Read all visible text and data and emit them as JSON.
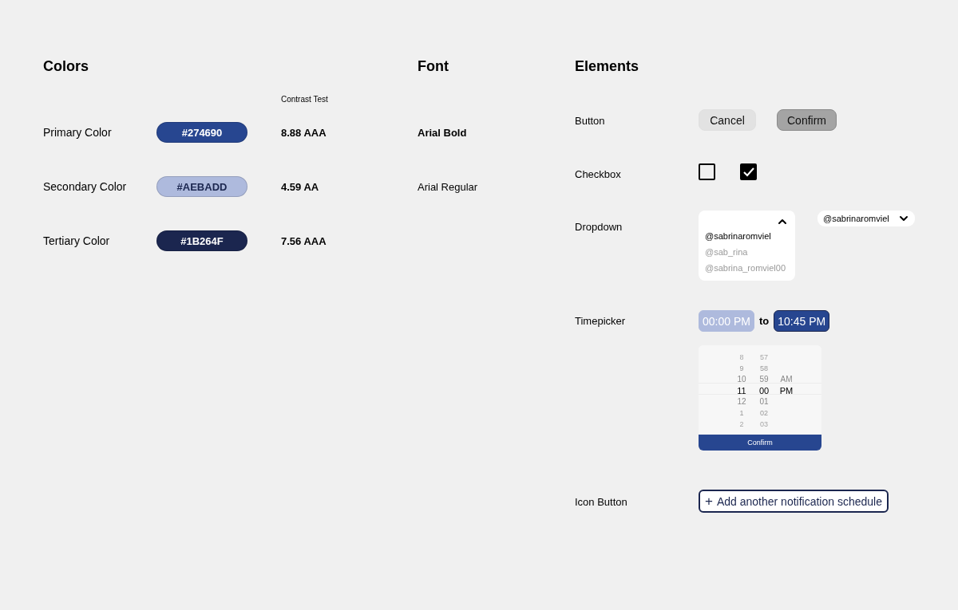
{
  "colors": {
    "title": "Colors",
    "contrast_heading": "Contrast Test",
    "rows": [
      {
        "name": "Primary Color",
        "hex": "#274690",
        "color": "#274690",
        "contrast": "8.88 AAA"
      },
      {
        "name": "Secondary Color",
        "hex": "#AEBADD",
        "color": "#aebadd",
        "contrast": "4.59 AA"
      },
      {
        "name": "Tertiary Color",
        "hex": "#1B264F",
        "color": "#1b264f",
        "contrast": "7.56 AAA"
      }
    ]
  },
  "font": {
    "title": "Font",
    "samples": [
      {
        "label": "Arial Bold",
        "kind": "bold"
      },
      {
        "label": "Arial Regular",
        "kind": "regular"
      }
    ]
  },
  "elements": {
    "title": "Elements",
    "rows": [
      {
        "kind": "buttons",
        "label": "Button",
        "buttons": [
          {
            "label": "Cancel",
            "kind": "secondary"
          },
          {
            "label": "Confirm",
            "kind": "primary"
          }
        ]
      },
      {
        "kind": "checkboxes",
        "label": "Checkbox",
        "checkboxes": [
          {
            "checked": false
          },
          {
            "checked": true
          }
        ]
      },
      {
        "kind": "dropdown",
        "label": "Dropdown",
        "open_menu": {
          "expanded": true,
          "options": [
            {
              "label": "@sabrinaromviel",
              "selected": true
            },
            {
              "label": "@sab_rina",
              "selected": false
            },
            {
              "label": "@sabrina_romviel00",
              "selected": false
            }
          ]
        },
        "closed_menu": {
          "expanded": false,
          "value": "@sabrinaromviel"
        }
      },
      {
        "kind": "timepicker",
        "label": "Timepicker",
        "from": {
          "value": "00:00 PM",
          "selected": false
        },
        "separator": "to",
        "to": {
          "value": "10:45 PM",
          "selected": true
        },
        "wheel": {
          "columns": [
            {
              "items": [
                {
                  "label": "8",
                  "selected": false
                },
                {
                  "label": "9",
                  "selected": false
                },
                {
                  "label": "10",
                  "selected": false
                },
                {
                  "label": "11",
                  "selected": true
                },
                {
                  "label": "12",
                  "selected": false
                },
                {
                  "label": "1",
                  "selected": false
                },
                {
                  "label": "2",
                  "selected": false
                }
              ]
            },
            {
              "items": [
                {
                  "label": "57",
                  "selected": false
                },
                {
                  "label": "58",
                  "selected": false
                },
                {
                  "label": "59",
                  "selected": false
                },
                {
                  "label": "00",
                  "selected": true
                },
                {
                  "label": "01",
                  "selected": false
                },
                {
                  "label": "02",
                  "selected": false
                },
                {
                  "label": "03",
                  "selected": false
                }
              ]
            },
            {
              "items": [
                {
                  "label": "AM",
                  "selected": false
                },
                {
                  "label": "PM",
                  "selected": true
                }
              ]
            }
          ],
          "confirm": "Confirm"
        }
      },
      {
        "kind": "icon_button",
        "label": "Icon Button",
        "icon": "+",
        "text": "Add another notification schedule"
      }
    ]
  }
}
